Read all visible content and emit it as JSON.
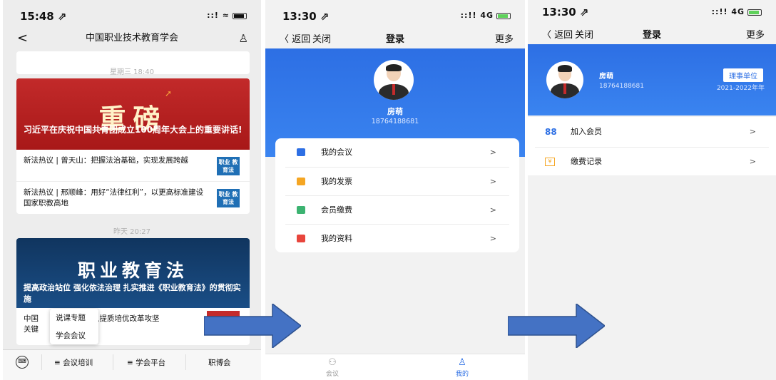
{
  "panel1": {
    "status": {
      "time": "15:48 ⇗",
      "signal": "::! ≈"
    },
    "nav": {
      "back": "<",
      "title": "中国职业技术教育学会",
      "user_icon": "user-icon"
    },
    "timestamp1": "星期三 18:40",
    "article1": {
      "headline": "重磅",
      "caption": "习近平在庆祝中国共青团成立100周年大会上的重要讲话!",
      "items": [
        {
          "text": "新法热议 | 曾天山：把握法治基础，实现发展跨越",
          "thumb": "职业 教育法"
        },
        {
          "text": "新法热议 | 邢顺峰：用好“法律红利”，以更高标准建设国家职教高地",
          "thumb": "职业 教育法"
        }
      ]
    },
    "timestamp2": "昨天 20:27",
    "article2": {
      "headline": "职业教育法",
      "caption": "提高政治站位 强化依法治理 扎实推进《职业教育法》的贯彻实施",
      "tail_prefix": "中国",
      "tail_suffix": "攻进入提质培优改革攻坚",
      "tail_line2": "关键"
    },
    "popup": [
      "说课专题",
      "学会会议"
    ],
    "menu": {
      "m1": "≡ 会议培训",
      "m2": "≡ 学会平台",
      "m3": "职博会"
    }
  },
  "panel2": {
    "status": {
      "time": "13:30 ⇗",
      "signal": "::!! 4G"
    },
    "nav": {
      "back": "〈 返回",
      "close": "关闭",
      "title": "登录",
      "more": "更多"
    },
    "profile": {
      "name": "房萌",
      "phone": "18764188681"
    },
    "menu": [
      {
        "label": "我的会议",
        "color": "#2d6fe4"
      },
      {
        "label": "我的发票",
        "color": "#f5a623"
      },
      {
        "label": "会员缴费",
        "color": "#3cb371"
      },
      {
        "label": "我的资料",
        "color": "#e8453c"
      }
    ],
    "chevron": ">",
    "tabs": [
      {
        "label": "会议",
        "icon": "⚇"
      },
      {
        "label": "我的",
        "icon": "♙"
      }
    ],
    "accent": "#2d6fe4"
  },
  "panel3": {
    "status": {
      "time": "13:30 ⇗",
      "signal": "::!! 4G"
    },
    "nav": {
      "back": "〈 返回",
      "close": "关闭",
      "title": "登录",
      "more": "更多"
    },
    "profile": {
      "name": "房萌",
      "phone": "18764188681",
      "tag": "理事单位",
      "period": "2021-2022年年"
    },
    "menu": [
      {
        "label": "加入会员",
        "icon": "88"
      },
      {
        "label": "缴费记录",
        "icon": "¥"
      }
    ],
    "chevron": ">"
  },
  "arrows_color": "#4472c4"
}
